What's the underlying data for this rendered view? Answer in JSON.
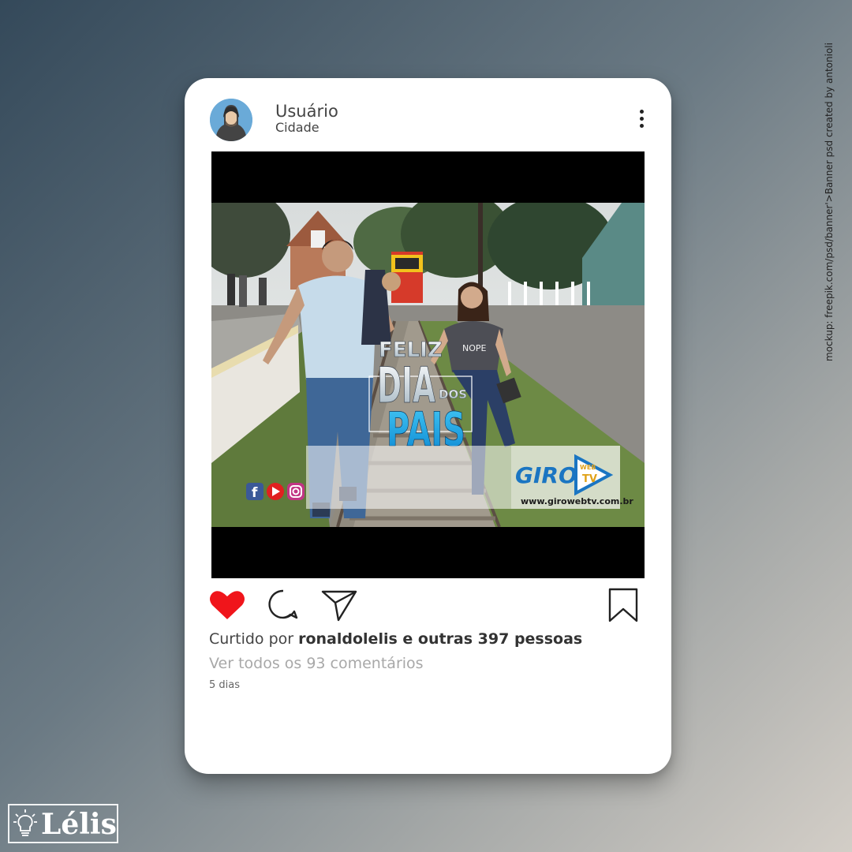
{
  "credit": "mockup: freepik.com/psd/banner'>Banner psd created by antonioli",
  "post": {
    "username": "Usuário",
    "location": "Cidade",
    "image": {
      "headline_top": "FELIZ",
      "headline_mid": "DIA",
      "headline_small": "DOS",
      "headline_bottom": "PAIS",
      "logo_giro": "GIRO",
      "logo_web": "WEB",
      "logo_tv": "TV",
      "website": "www.girowebtv.com.br",
      "shirt_text": "NOPE"
    },
    "liked_prefix": "Curtido por ",
    "liked_bold": "ronaldolelis e outras 397 pessoas",
    "comments": "Ver todos os 93 comentários",
    "time": "5 dias",
    "like_color": "#f0151b"
  },
  "brand": {
    "name": "Lélis"
  }
}
